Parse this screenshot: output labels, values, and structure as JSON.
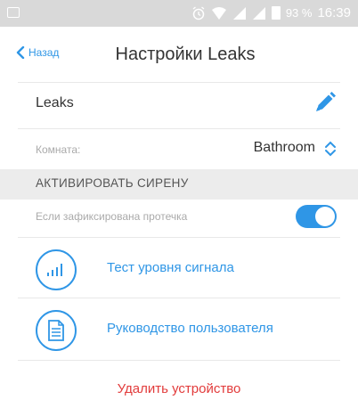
{
  "status_bar": {
    "battery_percent": "93 %",
    "time": "16:39"
  },
  "nav": {
    "back_label": "Назад",
    "title": "Настройки Leaks"
  },
  "device": {
    "name": "Leaks"
  },
  "room": {
    "label": "Комната:",
    "value": "Bathroom"
  },
  "siren_section": {
    "title": "АКТИВИРОВАТЬ СИРЕНУ",
    "leak_label": "Если зафиксирована протечка",
    "leak_enabled": true
  },
  "actions": [
    {
      "label": "Тест уровня сигнала",
      "icon": "signal-bars-icon"
    },
    {
      "label": "Руководство пользователя",
      "icon": "document-icon"
    }
  ],
  "delete_label": "Удалить устройство",
  "colors": {
    "accent": "#2f96e6",
    "danger": "#e23b3b",
    "statusbar": "#d9d9d9"
  }
}
